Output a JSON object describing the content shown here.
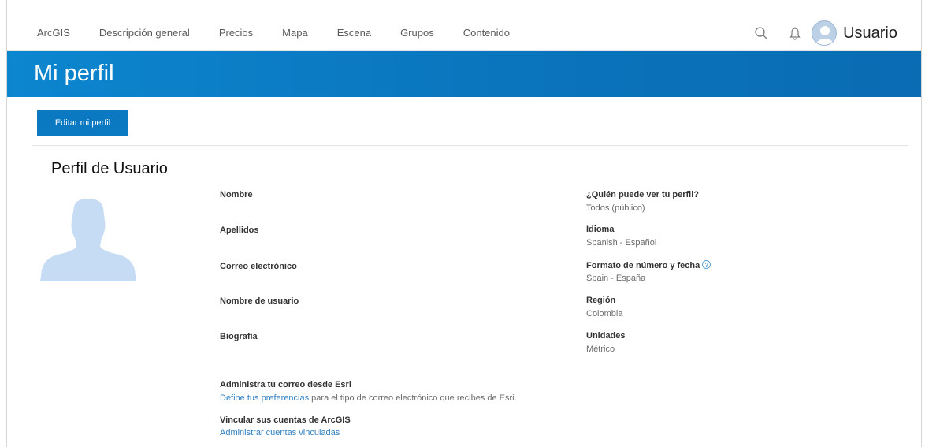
{
  "nav": {
    "items": [
      "ArcGIS",
      "Descripción general",
      "Precios",
      "Mapa",
      "Escena",
      "Grupos",
      "Contenido"
    ],
    "user_name": "Usuario"
  },
  "banner": {
    "title": "Mi perfil"
  },
  "actions": {
    "edit_label": "Editar mi perfil"
  },
  "profile": {
    "section_title": "Perfil de Usuario",
    "left_fields": {
      "first_name": "Nombre",
      "last_name": "Apellidos",
      "email": "Correo electrónico",
      "username": "Nombre de usuario",
      "bio": "Biografía"
    },
    "right_fields": {
      "visibility_label": "¿Quién puede ver tu perfil?",
      "visibility_value": "Todos (público)",
      "language_label": "Idioma",
      "language_value": "Spanish - Español",
      "format_label": "Formato de número y fecha",
      "format_value": "Spain - España",
      "region_label": "Región",
      "region_value": "Colombia",
      "units_label": "Unidades",
      "units_value": "Métrico"
    },
    "email_prefs": {
      "label": "Administra tu correo desde Esri",
      "link": "Define tus preferencias",
      "text": " para el tipo de correo electrónico que recibes de Esri."
    },
    "linked_accounts": {
      "label": "Vincular sus cuentas de ArcGIS",
      "link": "Administrar cuentas vinculadas"
    }
  },
  "colors": {
    "brand_blue": "#0b79c1",
    "link": "#2f7fc1"
  }
}
